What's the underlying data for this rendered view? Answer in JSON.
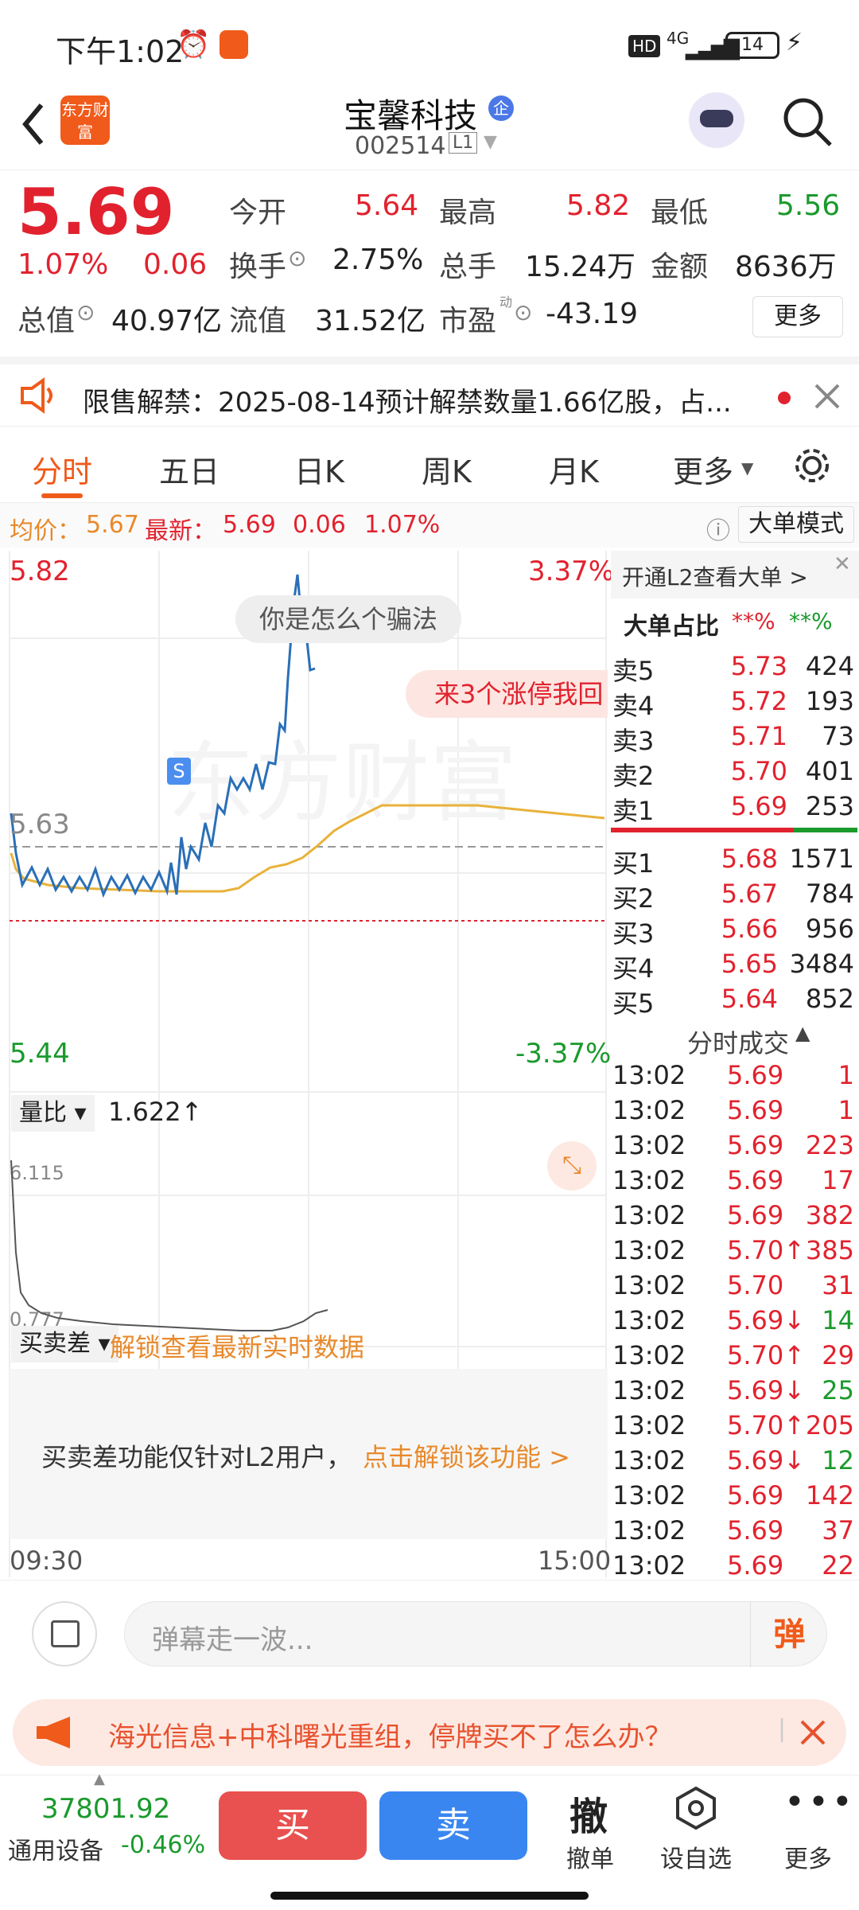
{
  "status": {
    "time": "下午1:02",
    "battery": "14",
    "network": "4G",
    "hd": "HD"
  },
  "header": {
    "title": "宝馨科技",
    "badge": "企",
    "code": "002514",
    "level": "L1",
    "logo": "东方财富"
  },
  "quote": {
    "price": "5.69",
    "pct": "1.07%",
    "chg": "0.06",
    "open_label": "今开",
    "open": "5.64",
    "high_label": "最高",
    "high": "5.82",
    "low_label": "最低",
    "low": "5.56",
    "turnover_label": "换手",
    "turnover": "2.75%",
    "volume_label": "总手",
    "volume": "15.24万",
    "amount_label": "金额",
    "amount": "8636万",
    "mktcap_label": "总值",
    "mktcap": "40.97亿",
    "float_label": "流值",
    "float": "31.52亿",
    "pe_label": "市盈",
    "pe_sup": "动",
    "pe": "-43.19",
    "more": "更多"
  },
  "notice": {
    "text": "限售解禁：2025-08-14预计解禁数量1.66亿股，占..."
  },
  "tabs": [
    "分时",
    "五日",
    "日K",
    "周K",
    "月K",
    "更多"
  ],
  "infobar": {
    "avg_label": "均价：",
    "avg": "5.67",
    "latest_label": "最新：",
    "latest": "5.69",
    "chg": "0.06",
    "pct": "1.07%",
    "mode": "大单模式"
  },
  "chart": {
    "top_price": "5.82",
    "top_pct": "3.37%",
    "mid_price": "5.63",
    "bottom_price": "5.44",
    "bottom_pct": "-3.37%",
    "s_marker": "S",
    "danmaku1": "你是怎么个骗法",
    "danmaku2": "来3个涨停我回",
    "watermark": "东方财富"
  },
  "volume": {
    "label": "量比",
    "ratio": "1.622↑",
    "top": "6.115",
    "bottom": "0.777"
  },
  "bsdiff": {
    "label": "买卖差",
    "unlock": "解锁查看最新实时数据",
    "msg": "买卖差功能仅针对L2用户，",
    "link": "点击解锁该功能 >"
  },
  "time_axis": {
    "start": "09:30",
    "end": "15:00"
  },
  "orderbook": {
    "l2": "开通L2查看大单 >",
    "big_label": "大单占比",
    "big_red": "**%",
    "big_green": "**%",
    "asks": [
      {
        "l": "卖5",
        "p": "5.73",
        "v": "424"
      },
      {
        "l": "卖4",
        "p": "5.72",
        "v": "193"
      },
      {
        "l": "卖3",
        "p": "5.71",
        "v": "73"
      },
      {
        "l": "卖2",
        "p": "5.70",
        "v": "401"
      },
      {
        "l": "卖1",
        "p": "5.69",
        "v": "253"
      }
    ],
    "bids": [
      {
        "l": "买1",
        "p": "5.68",
        "v": "1571"
      },
      {
        "l": "买2",
        "p": "5.67",
        "v": "784"
      },
      {
        "l": "买3",
        "p": "5.66",
        "v": "956"
      },
      {
        "l": "买4",
        "p": "5.65",
        "v": "3484"
      },
      {
        "l": "买5",
        "p": "5.64",
        "v": "852"
      }
    ],
    "trades_label": "分时成交",
    "trades": [
      {
        "t": "13:02",
        "p": "5.69",
        "v": "1",
        "a": ""
      },
      {
        "t": "13:02",
        "p": "5.69",
        "v": "1",
        "a": ""
      },
      {
        "t": "13:02",
        "p": "5.69",
        "v": "223",
        "a": ""
      },
      {
        "t": "13:02",
        "p": "5.69",
        "v": "17",
        "a": ""
      },
      {
        "t": "13:02",
        "p": "5.69",
        "v": "382",
        "a": ""
      },
      {
        "t": "13:02",
        "p": "5.70",
        "v": "385",
        "a": "↑"
      },
      {
        "t": "13:02",
        "p": "5.70",
        "v": "31",
        "a": ""
      },
      {
        "t": "13:02",
        "p": "5.69",
        "v": "14",
        "a": "↓"
      },
      {
        "t": "13:02",
        "p": "5.70",
        "v": "29",
        "a": "↑"
      },
      {
        "t": "13:02",
        "p": "5.69",
        "v": "25",
        "a": "↓"
      },
      {
        "t": "13:02",
        "p": "5.70",
        "v": "205",
        "a": "↑"
      },
      {
        "t": "13:02",
        "p": "5.69",
        "v": "12",
        "a": "↓"
      },
      {
        "t": "13:02",
        "p": "5.69",
        "v": "142",
        "a": ""
      },
      {
        "t": "13:02",
        "p": "5.69",
        "v": "37",
        "a": ""
      },
      {
        "t": "13:02",
        "p": "5.69",
        "v": "22",
        "a": ""
      }
    ]
  },
  "input": {
    "placeholder": "弹幕走一波...",
    "danmu": "弹"
  },
  "promo": {
    "text": "海光信息+中科曙光重组，停牌买不了怎么办？"
  },
  "footer": {
    "index_value": "37801.92",
    "index_name": "通用设备",
    "index_pct": "-0.46%",
    "buy": "买",
    "sell": "卖",
    "cancel_icon": "撤",
    "cancel": "撤单",
    "watch": "设自选",
    "more": "更多"
  },
  "colors": {
    "up": "#e1222e",
    "down": "#1a9a2c",
    "accent": "#f05a1a",
    "price_line": "#2a6fb8",
    "avg_line": "#e8b23a"
  }
}
